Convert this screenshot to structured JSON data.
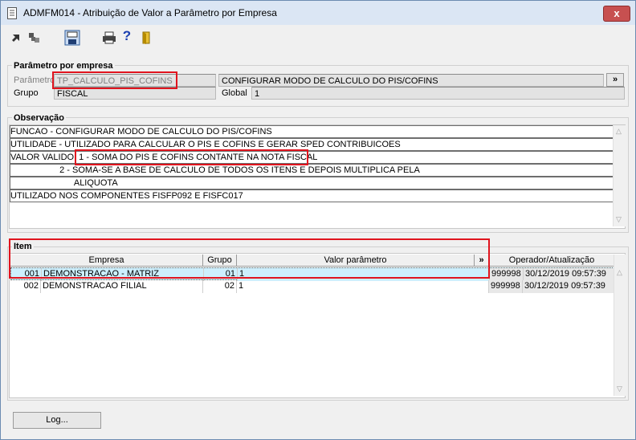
{
  "window": {
    "title": "ADMFM014 - Atribuição de Valor a Parâmetro por Empresa",
    "close_symbol": "x"
  },
  "toolbar": {
    "icons": [
      "back-icon",
      "tree-icon",
      "save-icon",
      "print-icon",
      "help-icon",
      "exit-door-icon"
    ],
    "help_glyph": "?"
  },
  "parametro": {
    "section_title": "Parâmetro por empresa",
    "parametro_label": "Parâmetro",
    "parametro_value": "TP_CALCULO_PIS_COFINS",
    "descricao_value": "CONFIGURAR MODO DE CALCULO DO PIS/COFINS",
    "expand_label": "»",
    "grupo_label": "Grupo",
    "grupo_value": "FISCAL",
    "global_label": "Global",
    "global_value": "1"
  },
  "observacao": {
    "section_title": "Observação",
    "lines": [
      "FUNCAO - CONFIGURAR MODO DE CALCULO DO PIS/COFINS",
      "UTILIDADE - UTILIZADO PARA CALCULAR O PIS E COFINS E GERAR SPED CONTRIBUICOES",
      "VALOR VALIDO: 1 - SOMA DO PIS E COFINS CONTANTE NA NOTA FISCAL",
      "                    2 - SOMA-SE A BASE DE CALCULO DE TODOS OS ITENS E DEPOIS MULTIPLICA PELA",
      "                          ALIQUOTA",
      "UTILIZADO NOS COMPONENTES FISFP092 E FISFC017"
    ]
  },
  "item": {
    "section_title": "Item",
    "columns": {
      "empresa": "Empresa",
      "grupo": "Grupo",
      "valor": "Valor parâmetro",
      "expand": "»",
      "operador": "Operador/Atualização"
    },
    "rows": [
      {
        "code": "001",
        "empresa": "DEMONSTRACAO - MATRIZ",
        "grupo": "01",
        "valor": "1",
        "operador": "999998",
        "atualizacao": "30/12/2019 09:57:39"
      },
      {
        "code": "002",
        "empresa": "DEMONSTRACAO FILIAL",
        "grupo": "02",
        "valor": "1",
        "operador": "999998",
        "atualizacao": "30/12/2019 09:57:39"
      }
    ]
  },
  "footer": {
    "log_button": "Log..."
  },
  "colors": {
    "highlight": "#e0141e",
    "selected_row": "#cdeffd",
    "titlebar": "#dbe6f4"
  }
}
